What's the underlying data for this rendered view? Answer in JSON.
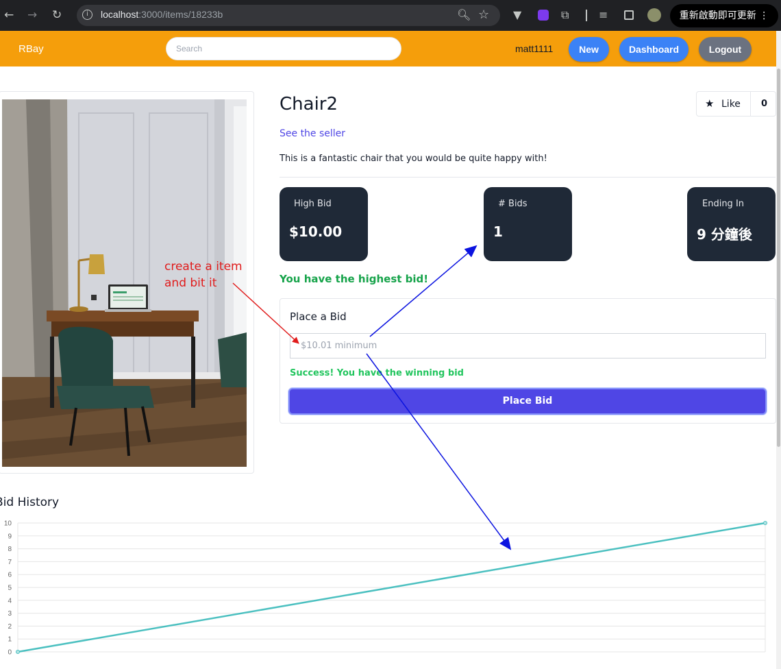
{
  "browser": {
    "url_host": "localhost",
    "url_path": ":3000/items/18233b",
    "update_label": "重新啟動即可更新 ⋮"
  },
  "header": {
    "brand": "RBay",
    "search_placeholder": "Search",
    "username": "matt1111",
    "new_label": "New",
    "dashboard_label": "Dashboard",
    "logout_label": "Logout",
    "colors": {
      "bar": "#f59e0b",
      "primary_pill": "#3b82f6",
      "logout_pill": "#6b7280"
    }
  },
  "item": {
    "title": "Chair2",
    "seller_link": "See the seller",
    "description": "This is a fantastic chair that you would be quite happy with!",
    "like_label": "Like",
    "like_count": "0",
    "stats": [
      {
        "label": "High Bid",
        "value": "$10.00"
      },
      {
        "label": "# Bids",
        "value": "1"
      },
      {
        "label": "Ending In",
        "value": "9 分鐘後"
      }
    ],
    "highest_message": "You have the highest bid!"
  },
  "bid_form": {
    "title": "Place a Bid",
    "placeholder": "$10.01 minimum",
    "success_message": "Success! You have the winning bid",
    "button_label": "Place Bid"
  },
  "annotation": {
    "line1": "create a item",
    "line2": "and bit it"
  },
  "chart_data": {
    "type": "line",
    "title": "Bid History",
    "xlabel": "",
    "ylabel": "",
    "ylim": [
      0,
      10
    ],
    "y_ticks": [
      "0",
      "1",
      "2",
      "3",
      "4",
      "5",
      "6",
      "7",
      "8",
      "9",
      "10"
    ],
    "series": [
      {
        "color": "#4bc0c0",
        "x": [
          0,
          1
        ],
        "values": [
          0,
          10
        ]
      }
    ],
    "grid": true
  }
}
